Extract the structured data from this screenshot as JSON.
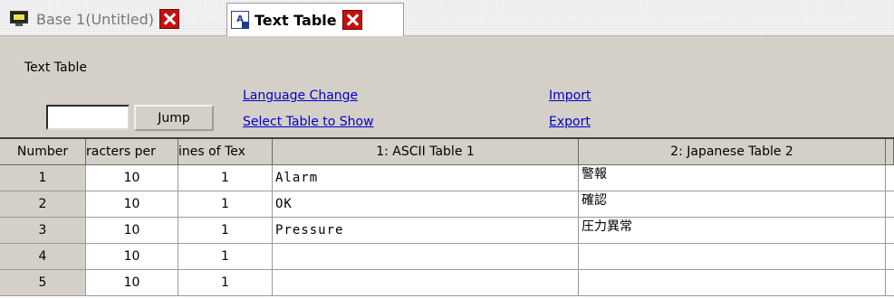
{
  "tabs": [
    {
      "label": "Base 1(Untitled)",
      "icon": "base-screen-icon"
    },
    {
      "label": "Text Table",
      "icon": "text-table-icon"
    }
  ],
  "panel": {
    "title": "Text Table",
    "jump_value": "",
    "jump_label": "Jump",
    "language_change": "Language Change",
    "select_table": "Select Table to Show",
    "import": "Import",
    "export": "Export"
  },
  "grid": {
    "headers": [
      "Number",
      "racters per",
      "ines of Tex",
      "1: ASCII Table 1",
      "2: Japanese Table 2"
    ],
    "rows": [
      {
        "number": "1",
        "chars": "10",
        "lines": "1",
        "ascii": "Alarm",
        "japanese": "警報"
      },
      {
        "number": "2",
        "chars": "10",
        "lines": "1",
        "ascii": "OK",
        "japanese": "確認"
      },
      {
        "number": "3",
        "chars": "10",
        "lines": "1",
        "ascii": "Pressure",
        "japanese": "圧力異常"
      },
      {
        "number": "4",
        "chars": "10",
        "lines": "1",
        "ascii": "",
        "japanese": ""
      },
      {
        "number": "5",
        "chars": "10",
        "lines": "1",
        "ascii": "",
        "japanese": ""
      }
    ]
  },
  "colors": {
    "close_red": "#c41010",
    "link_blue": "#0000cc",
    "panel_gray": "#d4d0c8"
  }
}
